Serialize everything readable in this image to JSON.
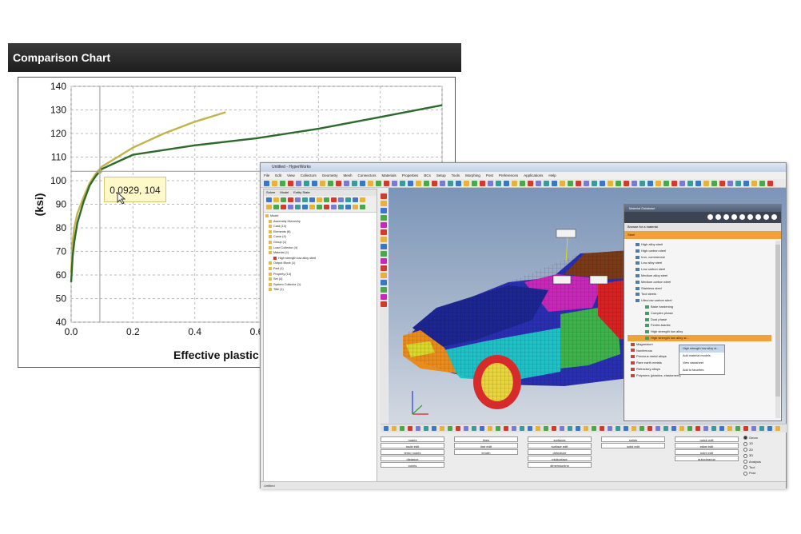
{
  "chart": {
    "header": "Comparison Chart",
    "tooltip": "0.0929, 104",
    "ylabel": "(ksi)",
    "xlabel": "Effective plastic s"
  },
  "chart_data": {
    "type": "line",
    "title": "Comparison Chart",
    "xlabel": "Effective plastic s",
    "ylabel": "(ksi)",
    "xlim": [
      0,
      1.2
    ],
    "ylim": [
      40,
      140
    ],
    "x_ticks": [
      "0.0",
      "0.2",
      "0.4",
      "0.6"
    ],
    "y_ticks": [
      "40",
      "50",
      "60",
      "70",
      "80",
      "90",
      "100",
      "110",
      "120",
      "130",
      "140"
    ],
    "grid": true,
    "series": [
      {
        "color": "#c2b44a",
        "x": [
          0.0,
          0.005,
          0.01,
          0.02,
          0.04,
          0.06,
          0.08,
          0.1,
          0.15,
          0.2,
          0.3,
          0.4,
          0.5
        ],
        "y": [
          61,
          74,
          80,
          86,
          93,
          99,
          103,
          106,
          110,
          114,
          120,
          125,
          129
        ]
      },
      {
        "color": "#2d6b2d",
        "x": [
          0.0,
          0.005,
          0.01,
          0.02,
          0.04,
          0.06,
          0.08,
          0.1,
          0.15,
          0.2,
          0.3,
          0.4,
          0.6,
          0.8,
          1.0,
          1.2
        ],
        "y": [
          57,
          68,
          74,
          82,
          91,
          98,
          102,
          105,
          108,
          111,
          113,
          115,
          118,
          122,
          127,
          132
        ]
      }
    ],
    "annotation": {
      "x": 0.0929,
      "y": 104,
      "text": "0.0929, 104"
    }
  },
  "app": {
    "title": "Untitled - HyperWorks",
    "menu": [
      "File",
      "Edit",
      "View",
      "Collectors",
      "Geometry",
      "Mesh",
      "Connectors",
      "Materials",
      "Properties",
      "BCs",
      "Setup",
      "Tools",
      "Morphing",
      "Post",
      "Preferences",
      "Applications",
      "Help"
    ],
    "browser_tabs": [
      "Solver",
      "Model",
      "Entity State"
    ],
    "tree": [
      "Model",
      "Assembly Hierarchy",
      "Card (14)",
      "Elements (8)",
      "Curve (4)",
      "Group (1)",
      "Load Collector (4)",
      "Material (1)",
      "High strength low alloy steel",
      "Output Block (1)",
      "Part (1)",
      "Property (14)",
      "Set (4)",
      "System Collector (1)",
      "Title (1)"
    ],
    "dialog": {
      "title": "Material Database",
      "subbar": "Browse for a material",
      "header": "Steel",
      "items": [
        "High alloy steel",
        "High carbon steel",
        "Iron, commercial",
        "Low alloy steel",
        "Low carbon steel",
        "Medium alloy steel",
        "Medium carbon steel",
        "Stainless steel",
        "Tool steels",
        "Ultra low carbon steel",
        "Bake hardening",
        "Complex phase",
        "Dual phase",
        "Ferrite-bainite",
        "High strength low alloy",
        "High strength low alloy st...",
        "Magnesium",
        "Nonferrous",
        "Precious metal alloys",
        "Rare earth metals",
        "Refractory alloys",
        "Polymers (plastics, elastomers)"
      ],
      "context_menu": [
        "High strength low alloy st...",
        "Add material models",
        "View datasheet",
        "Add to favorites"
      ]
    },
    "commands": [
      [
        "nodes",
        "lines",
        "surfaces",
        "solids",
        "quick edit"
      ],
      [
        "node edit",
        "line edit",
        "surface edit",
        "solid edit",
        "edge edit"
      ],
      [
        "temp nodes",
        "length",
        "defeature",
        "",
        "point edit"
      ],
      [
        "distance",
        "",
        "midsurface",
        "",
        "autocleanup"
      ],
      [
        "points",
        "",
        "dimensioning",
        "",
        ""
      ]
    ],
    "radios": [
      "Geom",
      "1D",
      "2D",
      "3D",
      "Analysis",
      "Tool",
      "Post"
    ],
    "radio_selected": "Geom",
    "status": "Untitled"
  }
}
